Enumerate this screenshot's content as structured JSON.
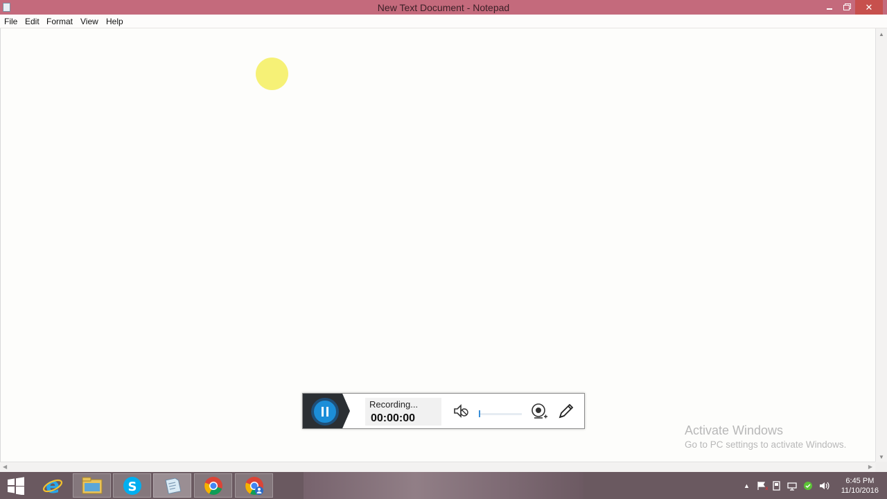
{
  "window": {
    "title": "New Text Document - Notepad",
    "close_symbol": "✕"
  },
  "menu": {
    "items": [
      "File",
      "Edit",
      "Format",
      "View",
      "Help"
    ]
  },
  "editor": {
    "content": ""
  },
  "recorder": {
    "status": "Recording...",
    "timer": "00:00:00"
  },
  "watermark": {
    "line1": "Activate Windows",
    "line2": "Go to PC settings to activate Windows."
  },
  "taskbar": {
    "apps": [
      "windows-start",
      "internet-explorer",
      "file-explorer",
      "skype",
      "notepad",
      "chrome",
      "chrome-profile"
    ],
    "clock_time": "6:45 PM",
    "clock_date": "11/10/2016"
  },
  "colors": {
    "titlebar": "#c46a7c",
    "close_button": "#c7504d",
    "record_accent": "#1c8ed8",
    "highlight_dot": "#f5f06a"
  }
}
